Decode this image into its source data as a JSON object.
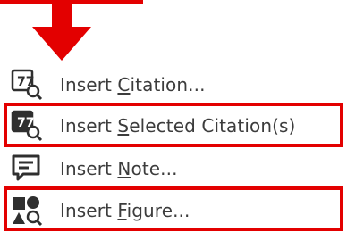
{
  "menu": {
    "items": [
      {
        "id": "insert-citation",
        "pre": "Insert ",
        "key": "C",
        "post": "itation...",
        "icon": "insert-citation-icon",
        "highlighted": false
      },
      {
        "id": "insert-selected-citations",
        "pre": "Insert ",
        "key": "S",
        "post": "elected Citation(s)",
        "icon": "insert-selected-citation-icon",
        "highlighted": true
      },
      {
        "id": "insert-note",
        "pre": "Insert ",
        "key": "N",
        "post": "ote...",
        "icon": "insert-note-icon",
        "highlighted": false
      },
      {
        "id": "insert-figure",
        "pre": "Insert ",
        "key": "F",
        "post": "igure...",
        "icon": "insert-figure-icon",
        "highlighted": true
      }
    ]
  },
  "colors": {
    "annotation_red": "#e30000",
    "icon_dark": "#2f2f2f",
    "text": "#3c3c3c"
  }
}
